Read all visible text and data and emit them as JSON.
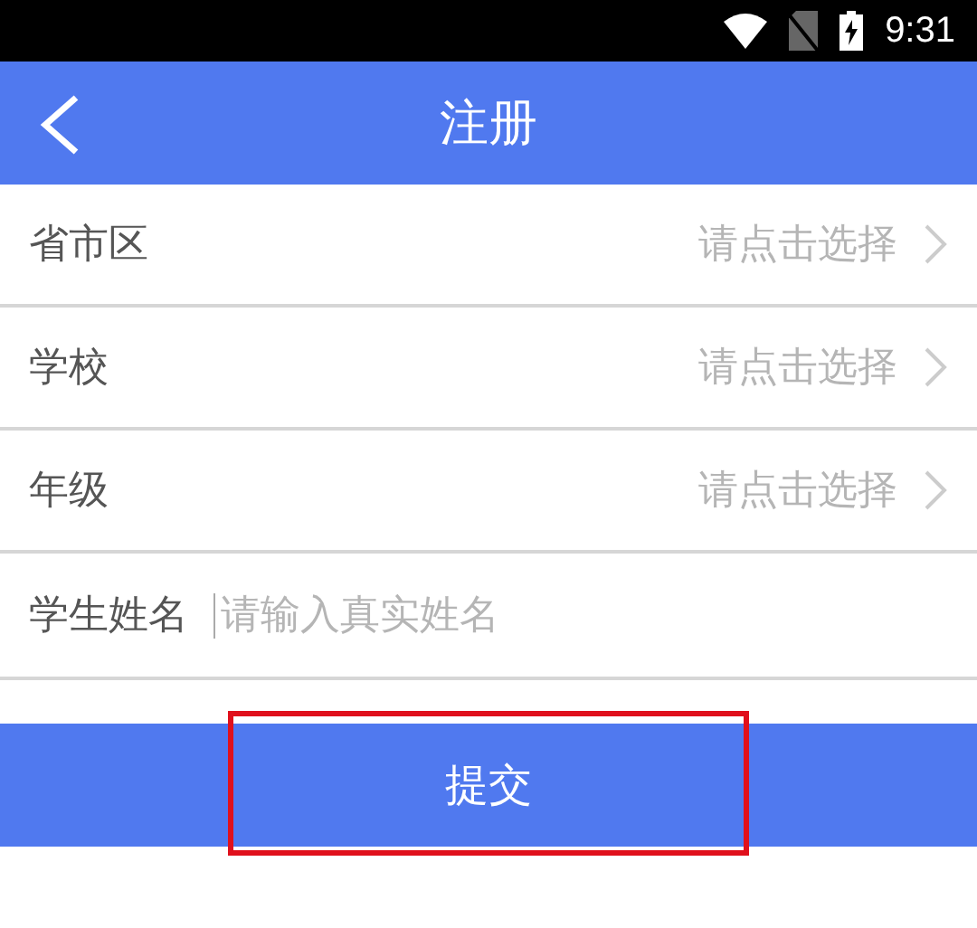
{
  "status_bar": {
    "time": "9:31"
  },
  "header": {
    "title": "注册"
  },
  "rows": [
    {
      "kind": "select",
      "label": "省市区",
      "placeholder": "请点击选择"
    },
    {
      "kind": "select",
      "label": "学校",
      "placeholder": "请点击选择"
    },
    {
      "kind": "select",
      "label": "年级",
      "placeholder": "请点击选择"
    },
    {
      "kind": "input",
      "label": "学生姓名",
      "placeholder": "请输入真实姓名",
      "focused": true
    }
  ],
  "submit": {
    "label": "提交",
    "highlighted": true
  }
}
